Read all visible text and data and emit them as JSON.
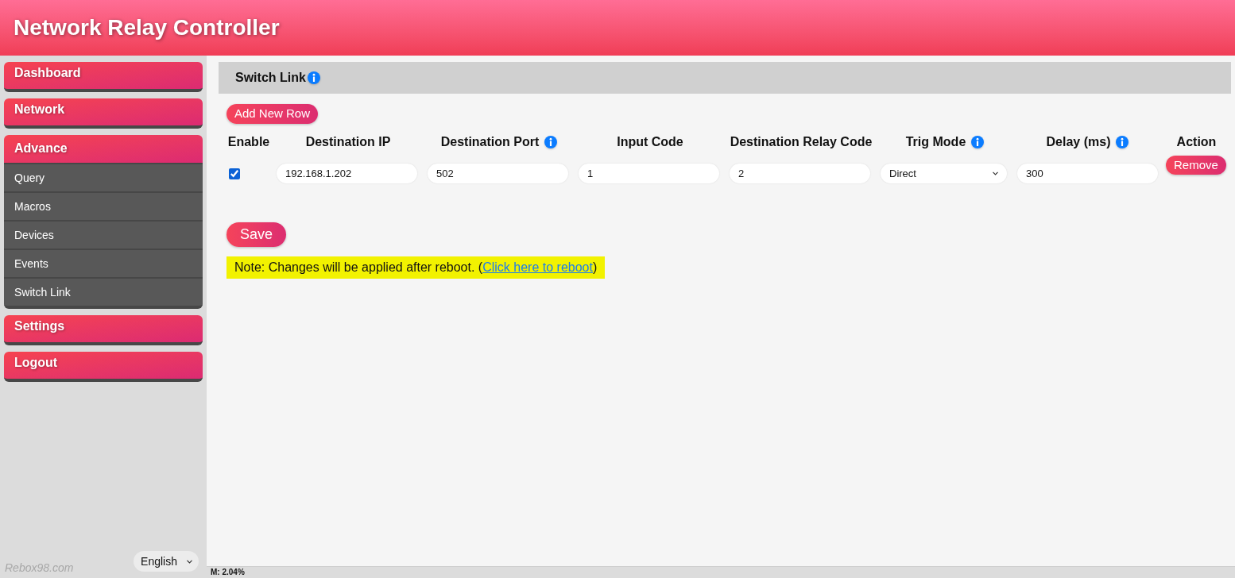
{
  "header": {
    "title": "Network Relay Controller"
  },
  "sidebar": {
    "items": [
      {
        "label": "Dashboard"
      },
      {
        "label": "Network"
      },
      {
        "label": "Advance",
        "children": [
          {
            "label": "Query"
          },
          {
            "label": "Macros"
          },
          {
            "label": "Devices"
          },
          {
            "label": "Events"
          },
          {
            "label": "Switch Link"
          }
        ]
      },
      {
        "label": "Settings"
      },
      {
        "label": "Logout"
      }
    ],
    "brand": "Rebox98.com",
    "language": "English"
  },
  "panel": {
    "title": "Switch Link",
    "title_info": true,
    "add_button": "Add New Row",
    "table": {
      "columns": [
        {
          "label": "Enable",
          "info": false
        },
        {
          "label": "Destination IP",
          "info": false
        },
        {
          "label": "Destination Port",
          "info": true
        },
        {
          "label": "Input Code",
          "info": false
        },
        {
          "label": "Destination Relay Code",
          "info": false
        },
        {
          "label": "Trig Mode",
          "info": true
        },
        {
          "label": "Delay (ms)",
          "info": true
        },
        {
          "label": "Action",
          "info": false
        }
      ],
      "rows": [
        {
          "cells": [
            {
              "kind": "checkbox",
              "checked": true
            },
            {
              "kind": "input",
              "value": "192.168.1.202"
            },
            {
              "kind": "input",
              "value": "502"
            },
            {
              "kind": "input",
              "value": "1"
            },
            {
              "kind": "input",
              "value": "2"
            },
            {
              "kind": "select",
              "value": "Direct"
            },
            {
              "kind": "input",
              "value": "300"
            },
            {
              "kind": "button",
              "label": "Remove"
            }
          ]
        }
      ]
    },
    "save_button": "Save",
    "note": {
      "text": "Note: Changes will be applied after reboot. (",
      "link": "Click here to reboot",
      "after": ")"
    }
  },
  "status_bar": {
    "text": "M: 2.04%"
  }
}
